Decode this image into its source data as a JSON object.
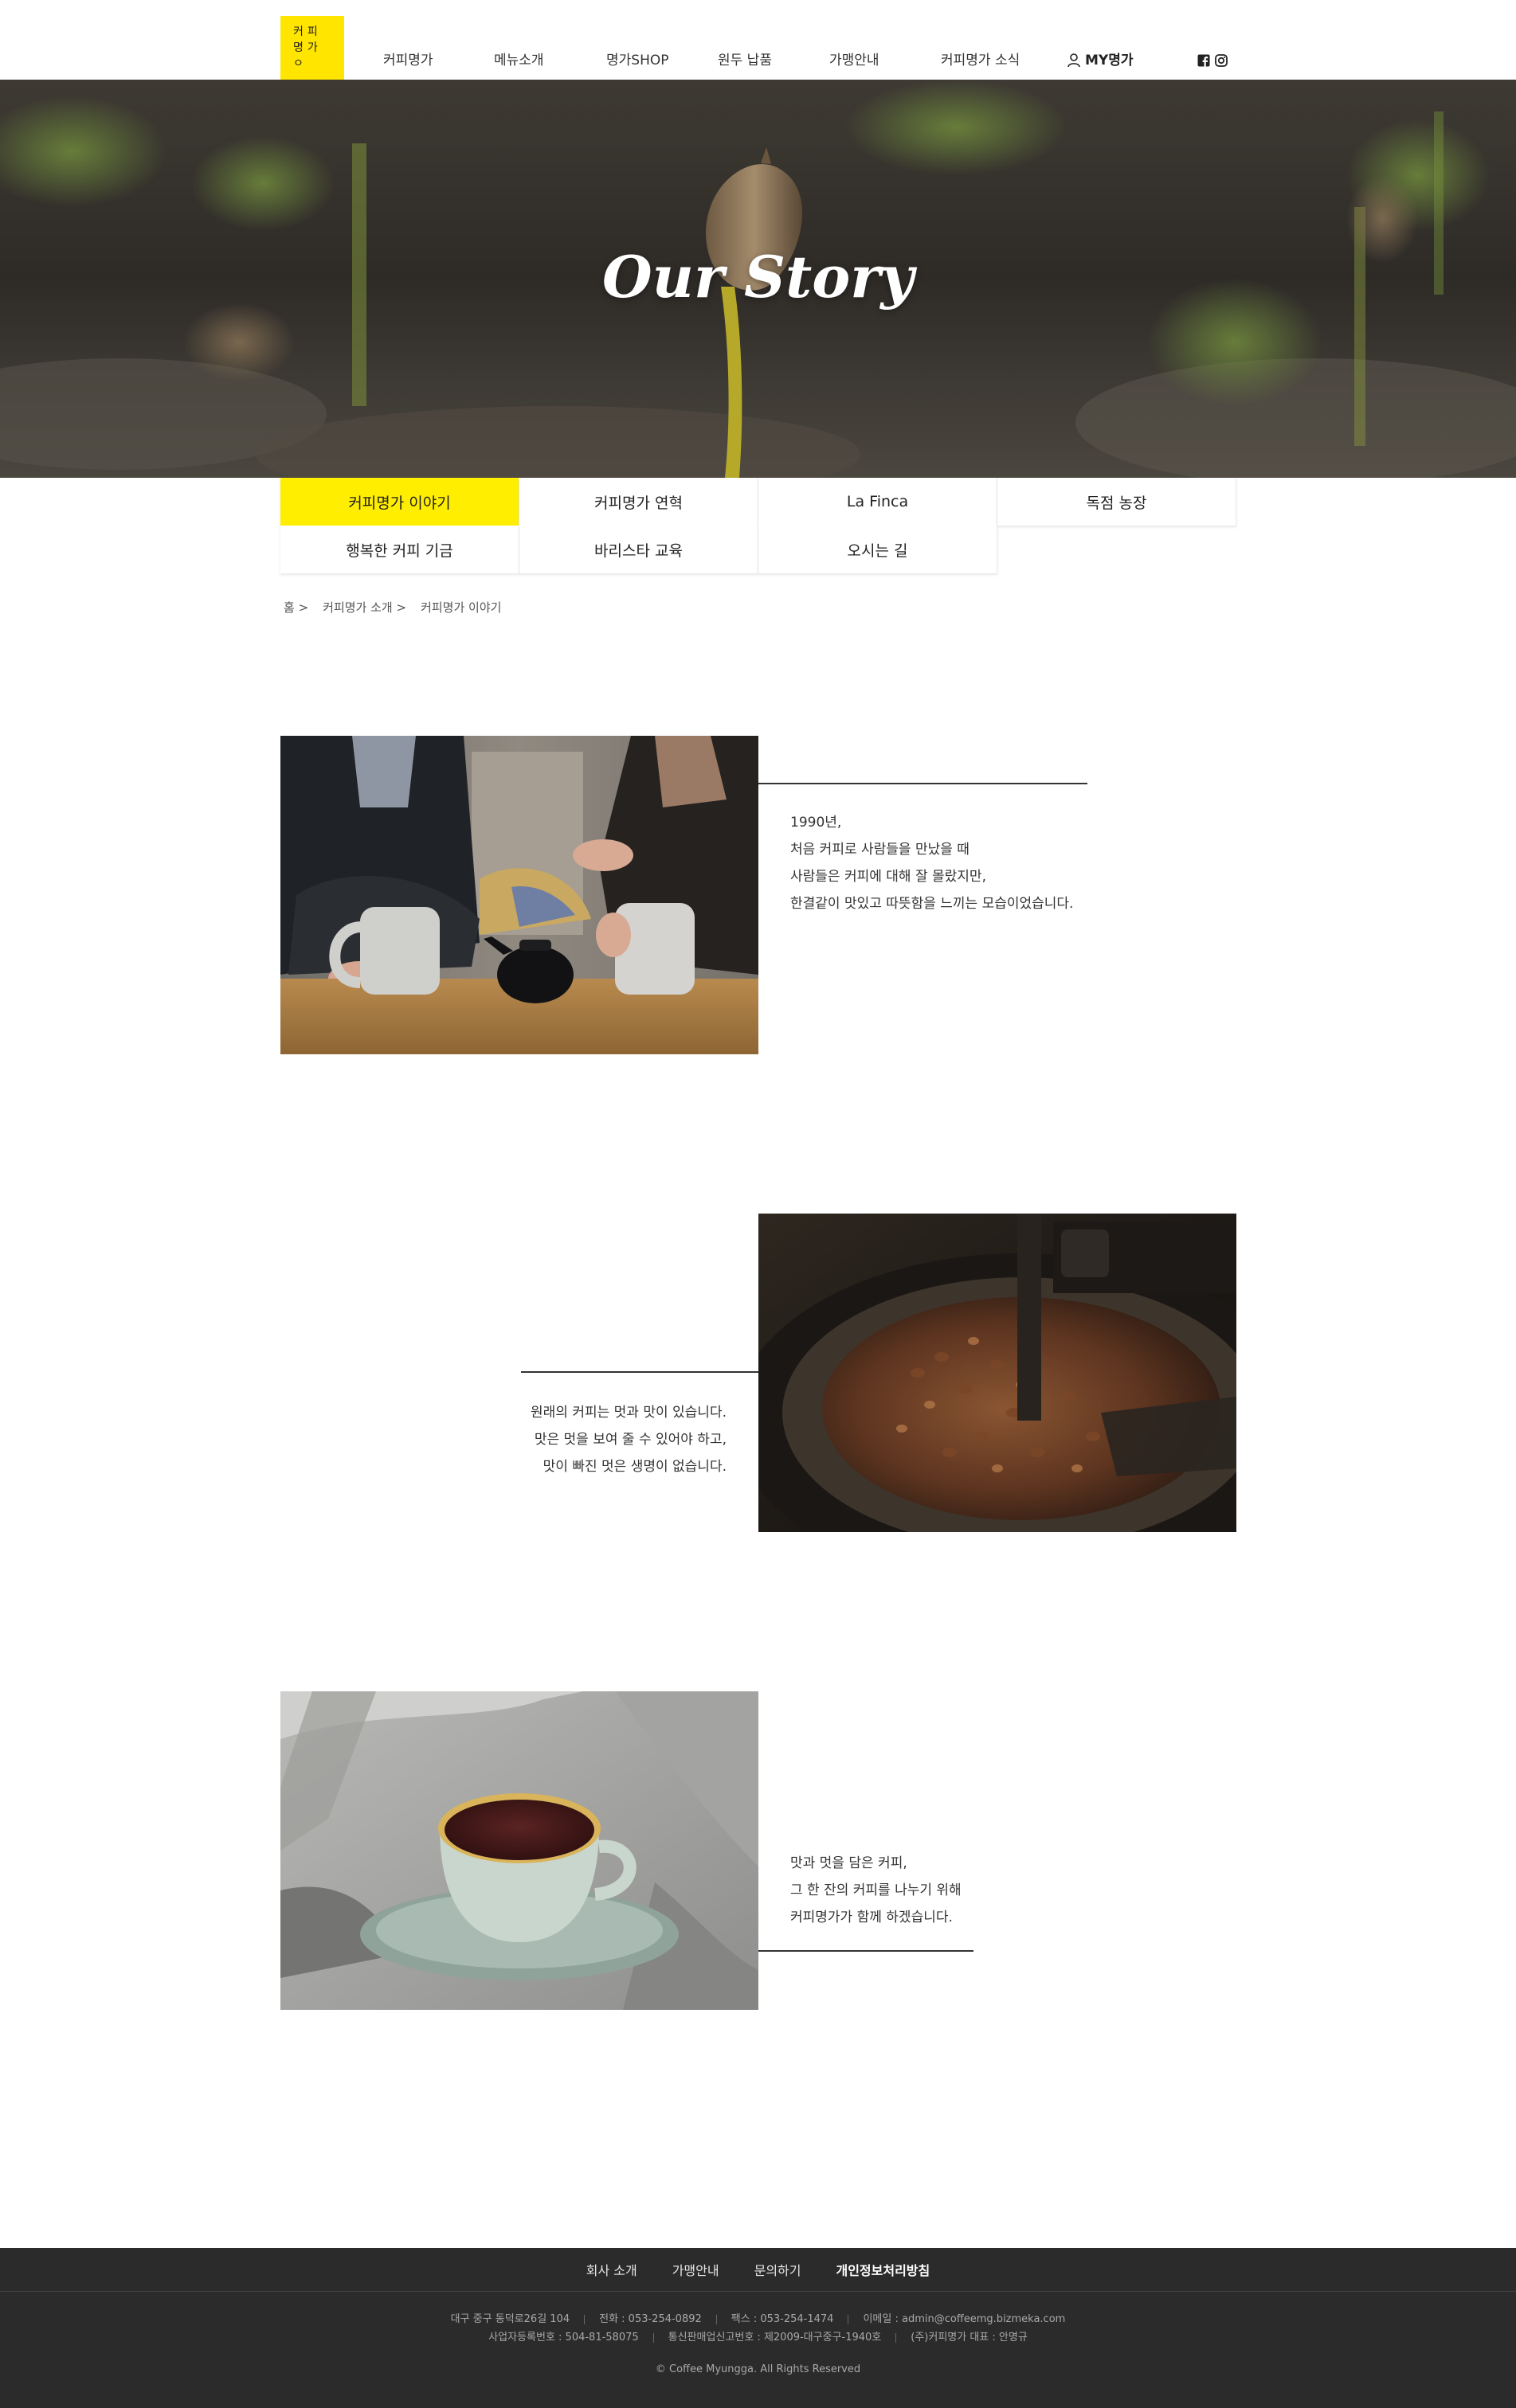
{
  "header": {
    "logo_lines": [
      "커피",
      "명가",
      "ㅇ"
    ],
    "nav": [
      "커피명가",
      "메뉴소개",
      "명가SHOP",
      "원두 납품",
      "가맹안내",
      "커피명가 소식"
    ],
    "my_menu": "MY명가",
    "social_icons": [
      "facebook-icon",
      "instagram-icon"
    ]
  },
  "hero": {
    "title": "Our Story"
  },
  "tabs": {
    "items": [
      "커피명가 이야기",
      "커피명가 연혁",
      "La Finca",
      "독점 농장",
      "행복한 커피 기금",
      "바리스타 교육",
      "오시는 길"
    ],
    "active": "커피명가 이야기",
    "active_color": "#ffee00"
  },
  "breadcrumb": [
    "홈 >",
    "커피명가 소개 >",
    "커피명가 이야기"
  ],
  "stories": [
    {
      "lines": [
        "1990년,",
        "처음 커피로 사람들을 만났을 때",
        "사람들은 커피에 대해 잘 몰랐지만,",
        "한결같이 맛있고 따뜻함을 느끼는 모습이었습니다."
      ]
    },
    {
      "lines": [
        "원래의 커피는 멋과 맛이 있습니다.",
        "맛은 멋을 보여 줄 수 있어야 하고,",
        "맛이 빠진 멋은 생명이 없습니다."
      ]
    },
    {
      "lines": [
        "맛과 멋을 담은 커피,",
        "그 한 잔의 커피를 나누기 위해",
        "커피명가가 함께 하겠습니다."
      ]
    }
  ],
  "footer": {
    "links": [
      "회사 소개",
      "가맹안내",
      "문의하기",
      "개인정보처리방침"
    ],
    "info_row1": [
      "대구 중구 동덕로26길 104",
      "전화 : 053-254-0892",
      "팩스 : 053-254-1474",
      "이메일 : admin@coffeemg.bizmeka.com"
    ],
    "info_row2": [
      "사업자등록번호 : 504-81-58075",
      "통신판매업신고번호 : 제2009-대구중구-1940호",
      "(주)커피명가 대표 : 안명규"
    ],
    "copyright": "© Coffee Myungga. All Rights Reserved"
  }
}
